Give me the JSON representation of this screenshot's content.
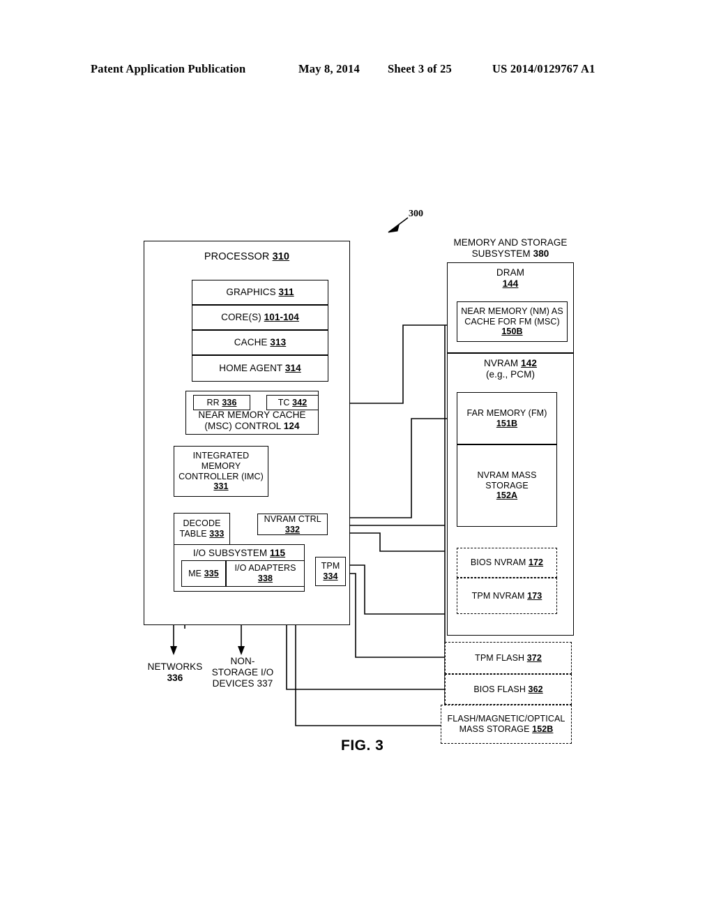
{
  "header": {
    "publication": "Patent Application Publication",
    "date": "May 8, 2014",
    "sheet": "Sheet 3 of 25",
    "number": "US 2014/0129767 A1"
  },
  "figure": {
    "caption": "FIG. 3",
    "system_ref": "300"
  },
  "processor": {
    "title_text": "PROCESSOR",
    "title_ref": "310",
    "blocks": [
      {
        "text": "GRAPHICS",
        "ref": "311"
      },
      {
        "text": "CORE(S)",
        "ref": "101-104"
      },
      {
        "text": "CACHE",
        "ref": "313"
      },
      {
        "text": "HOME AGENT",
        "ref": "314"
      }
    ],
    "msc": {
      "rr": {
        "text": "RR",
        "ref": "336"
      },
      "tc": {
        "text": "TC",
        "ref": "342"
      },
      "line1": "NEAR MEMORY CACHE",
      "line2_text": "(MSC) CONTROL",
      "line2_ref": "124"
    },
    "imc": {
      "line1": "INTEGRATED",
      "line2": "MEMORY",
      "line3": "CONTROLLER (IMC)",
      "ref": "331"
    },
    "decode_table": {
      "line1": "DECODE",
      "line2_text": "TABLE",
      "line2_ref": "333"
    },
    "nvram_ctrl": {
      "text": "NVRAM CTRL",
      "ref": "332"
    },
    "io_subsystem": {
      "title_text": "I/O SUBSYSTEM",
      "title_ref": "115",
      "me": {
        "text": "ME",
        "ref": "335"
      },
      "io_adapters": {
        "text": "I/O ADAPTERS",
        "ref": "338"
      }
    },
    "tpm": {
      "text": "TPM",
      "ref": "334"
    }
  },
  "external": {
    "networks": {
      "line1": "NETWORKS",
      "line2": "336"
    },
    "non_storage": {
      "line1": "NON-",
      "line2": "STORAGE I/O",
      "line3": "DEVICES 337"
    }
  },
  "memory_subsystem": {
    "title_line1": "MEMORY AND STORAGE",
    "title_line2_text": "SUBSYSTEM",
    "title_line2_ref": "380",
    "dram": {
      "title": "DRAM",
      "ref": "144",
      "inner": {
        "line1": "NEAR MEMORY (NM) AS",
        "line2": "CACHE FOR FM (MSC)",
        "ref": "150B"
      }
    },
    "nvram": {
      "title_text": "NVRAM",
      "title_ref": "142",
      "subtitle": "(e.g., PCM)",
      "far_memory": {
        "text": "FAR MEMORY (FM)",
        "ref": "151B"
      },
      "mass_storage": {
        "line1": "NVRAM MASS",
        "line2": "STORAGE",
        "ref": "152A"
      },
      "bios_nvram": {
        "text": "BIOS NVRAM",
        "ref": "172"
      },
      "tpm_nvram": {
        "text": "TPM NVRAM",
        "ref": "173"
      }
    },
    "flash": {
      "tpm_flash": {
        "text": "TPM FLASH",
        "ref": "372"
      },
      "bios_flash": {
        "text": "BIOS FLASH",
        "ref": "362"
      },
      "mass_storage": {
        "line1": "FLASH/MAGNETIC/OPTICAL",
        "line2_text": "MASS STORAGE",
        "line2_ref": "152B"
      }
    }
  },
  "colors": {
    "ink": "#000000",
    "paper": "#ffffff"
  }
}
